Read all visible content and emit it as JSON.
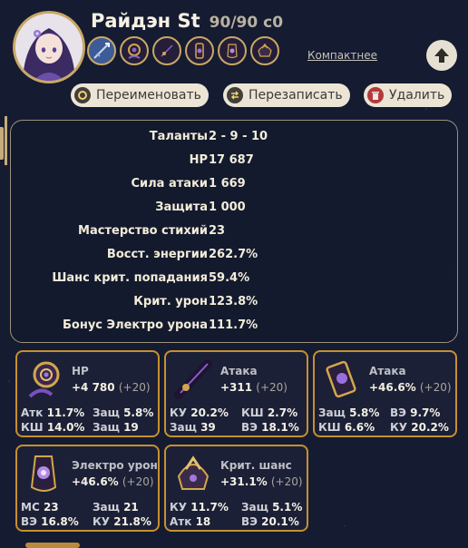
{
  "character": {
    "name": "Райдэн St",
    "level": "90/90 c0"
  },
  "header": {
    "compact_label": "Компактнее",
    "equip_icons": [
      "spear-weapon-icon",
      "flower-artifact-icon",
      "feather-artifact-icon",
      "sands-artifact-icon",
      "goblet-artifact-icon",
      "circlet-artifact-icon"
    ]
  },
  "actions": {
    "rename_label": "Переименовать",
    "rewrite_label": "Перезаписать",
    "delete_label": "Удалить"
  },
  "stats": [
    {
      "label": "Таланты",
      "value": "2 - 9 - 10"
    },
    {
      "label": "HP",
      "value": "17 687"
    },
    {
      "label": "Сила атаки",
      "value": "1 669"
    },
    {
      "label": "Защита",
      "value": "1 000"
    },
    {
      "label": "Мастерство стихий",
      "value": "23"
    },
    {
      "label": "Восст. энергии",
      "value": "262.7%"
    },
    {
      "label": "Шанс крит. попадания",
      "value": "59.4%"
    },
    {
      "label": "Крит. урон",
      "value": "123.8%"
    },
    {
      "label": "Бонус Электро урона",
      "value": "111.7%"
    }
  ],
  "artifacts": [
    {
      "icon": "flower-icon",
      "main_stat": "HP",
      "main_value": "+4 780",
      "level": "(+20)",
      "subs": [
        {
          "k": "Атк",
          "v": "11.7%"
        },
        {
          "k": "Защ",
          "v": "5.8%"
        },
        {
          "k": "КШ",
          "v": "14.0%"
        },
        {
          "k": "Защ",
          "v": "19"
        }
      ]
    },
    {
      "icon": "feather-icon",
      "main_stat": "Атака",
      "main_value": "+311",
      "level": "(+20)",
      "subs": [
        {
          "k": "КУ",
          "v": "20.2%"
        },
        {
          "k": "КШ",
          "v": "2.7%"
        },
        {
          "k": "Защ",
          "v": "39"
        },
        {
          "k": "ВЭ",
          "v": "18.1%"
        }
      ]
    },
    {
      "icon": "sands-icon",
      "main_stat": "Атака",
      "main_value": "+46.6%",
      "level": "(+20)",
      "subs": [
        {
          "k": "Защ",
          "v": "5.8%"
        },
        {
          "k": "ВЭ",
          "v": "9.7%"
        },
        {
          "k": "КШ",
          "v": "6.6%"
        },
        {
          "k": "КУ",
          "v": "20.2%"
        }
      ]
    },
    {
      "icon": "goblet-icon",
      "main_stat": "Электро урон",
      "main_value": "+46.6%",
      "level": "(+20)",
      "subs": [
        {
          "k": "МС",
          "v": "23"
        },
        {
          "k": "Защ",
          "v": "21"
        },
        {
          "k": "ВЭ",
          "v": "16.8%"
        },
        {
          "k": "КУ",
          "v": "21.8%"
        }
      ]
    },
    {
      "icon": "circlet-icon",
      "main_stat": "Крит. шанс",
      "main_value": "+31.1%",
      "level": "(+20)",
      "subs": [
        {
          "k": "КУ",
          "v": "11.7%"
        },
        {
          "k": "Защ",
          "v": "5.1%"
        },
        {
          "k": "Атк",
          "v": "18"
        },
        {
          "k": "ВЭ",
          "v": "20.1%"
        }
      ]
    }
  ],
  "colors": {
    "background": "#151b31",
    "gold_border": "#c7902e",
    "button_bg": "#ece5d5"
  }
}
